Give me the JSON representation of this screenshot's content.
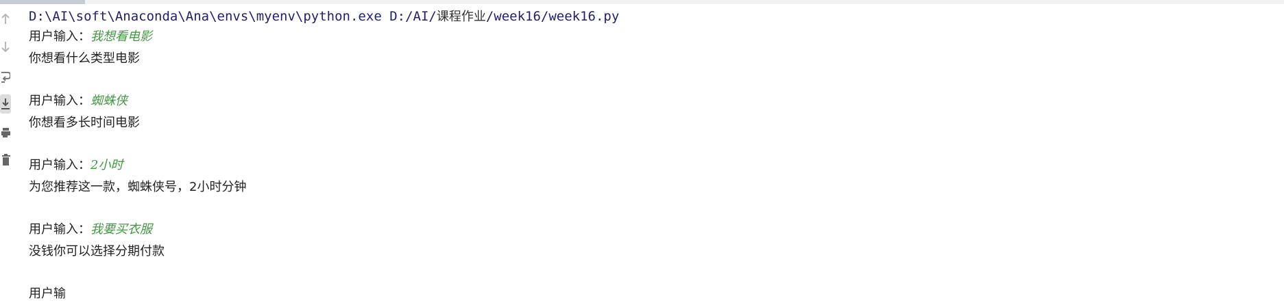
{
  "console": {
    "command": "D:\\AI\\soft\\Anaconda\\Ana\\envs\\myenv\\python.exe D:/AI/",
    "command_cjk": "课程作业",
    "command_tail": "/week16/week16.py",
    "exchanges": [
      {
        "prompt_label": "用户输入：",
        "user_input": "我想看电影",
        "response": "你想看什么类型电影"
      },
      {
        "prompt_label": "用户输入：",
        "user_input": "蜘蛛侠",
        "response": "你想看多长时间电影"
      },
      {
        "prompt_label": "用户输入：",
        "user_input": "2小时",
        "response": "为您推荐这一款，蜘蛛侠号，2小时分钟"
      },
      {
        "prompt_label": "用户输入：",
        "user_input": "我要买衣服",
        "response": "没钱你可以选择分期付款"
      }
    ],
    "truncated_last_line": "用户输"
  },
  "colors": {
    "command": "#1f1f6e",
    "user_input": "#3f9a3f",
    "text": "#222222"
  },
  "toolbar": {
    "icons": [
      "arrow-up-icon",
      "arrow-down-icon",
      "soft-wrap-icon",
      "scroll-to-end-icon",
      "print-icon",
      "trash-icon"
    ]
  }
}
